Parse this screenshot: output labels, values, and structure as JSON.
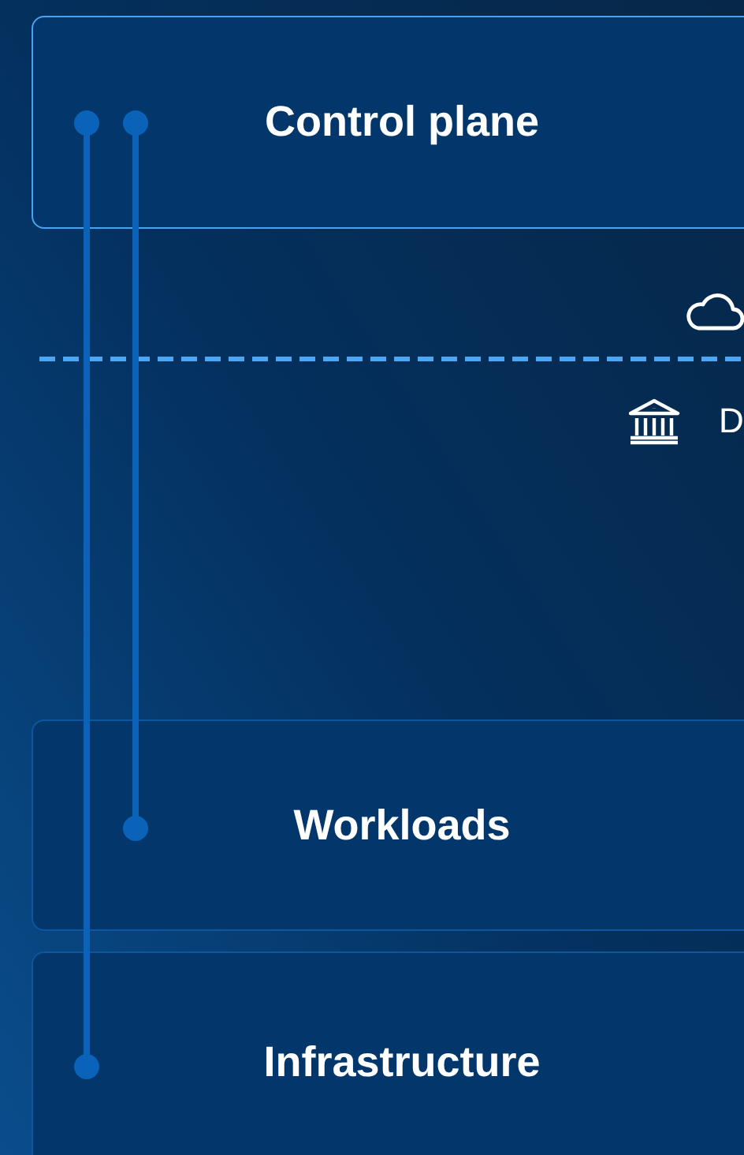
{
  "layers": [
    {
      "label": "Control plane",
      "highlighted": true
    },
    {
      "label": "Workloads",
      "highlighted": false
    },
    {
      "label": "Infrastructure",
      "highlighted": false
    }
  ],
  "boundary": {
    "lower_label": "D"
  }
}
